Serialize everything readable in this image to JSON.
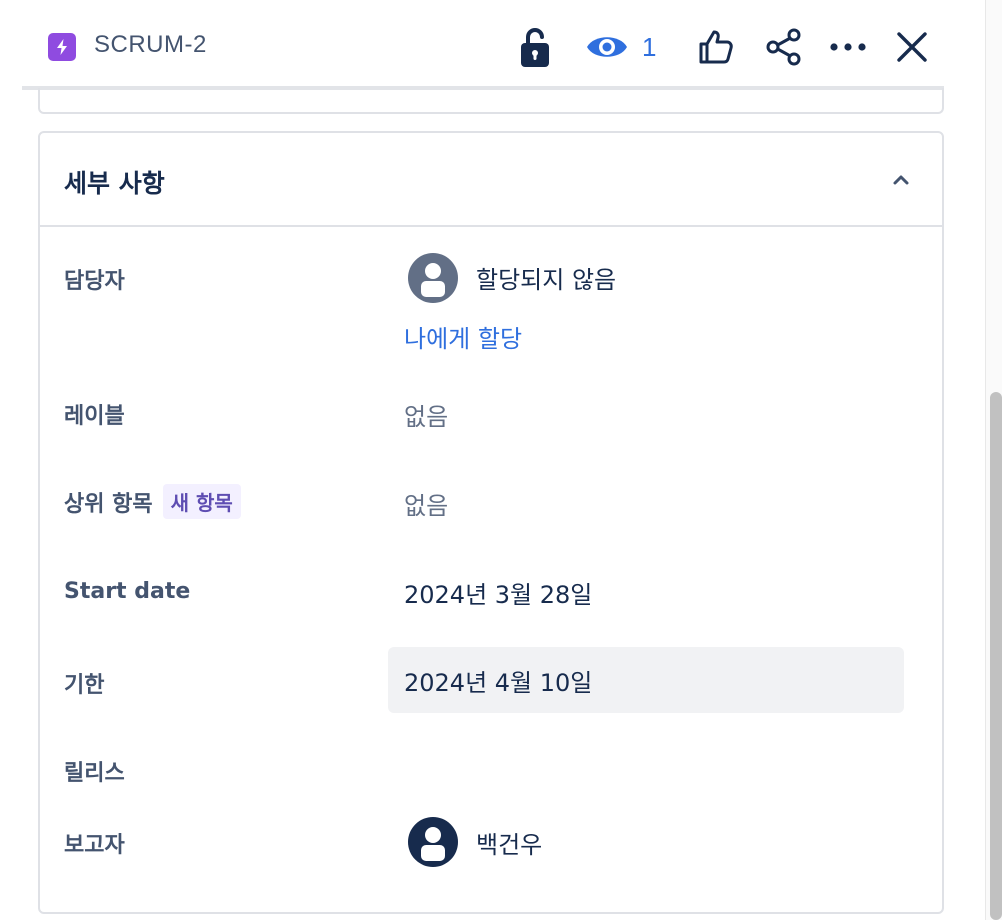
{
  "header": {
    "issue_key": "SCRUM-2",
    "issue_type_icon": "lightning-icon",
    "issue_type_color": "#8f4be0",
    "watch_count": "1",
    "actions": [
      "lock-icon",
      "eye-icon",
      "thumbs-up-icon",
      "share-icon",
      "more-icon",
      "close-icon"
    ]
  },
  "details": {
    "title": "세부 사항",
    "fields": {
      "assignee": {
        "label": "담당자",
        "value": "할당되지 않음",
        "assign_to_me": "나에게 할당"
      },
      "labels": {
        "label": "레이블",
        "value": "없음"
      },
      "parent": {
        "label": "상위 항목",
        "badge": "새 항목",
        "value": "없음"
      },
      "start_date": {
        "label": "Start date",
        "value": "2024년 3월 28일"
      },
      "due_date": {
        "label": "기한",
        "value": "2024년 4월 10일"
      },
      "release": {
        "label": "릴리스",
        "value": ""
      },
      "reporter": {
        "label": "보고자",
        "value": "백건우"
      }
    }
  },
  "colors": {
    "link": "#2f6fde",
    "badge_bg": "#f3f0ff",
    "badge_text": "#5e4db2",
    "hover_bg": "#f1f2f4"
  }
}
